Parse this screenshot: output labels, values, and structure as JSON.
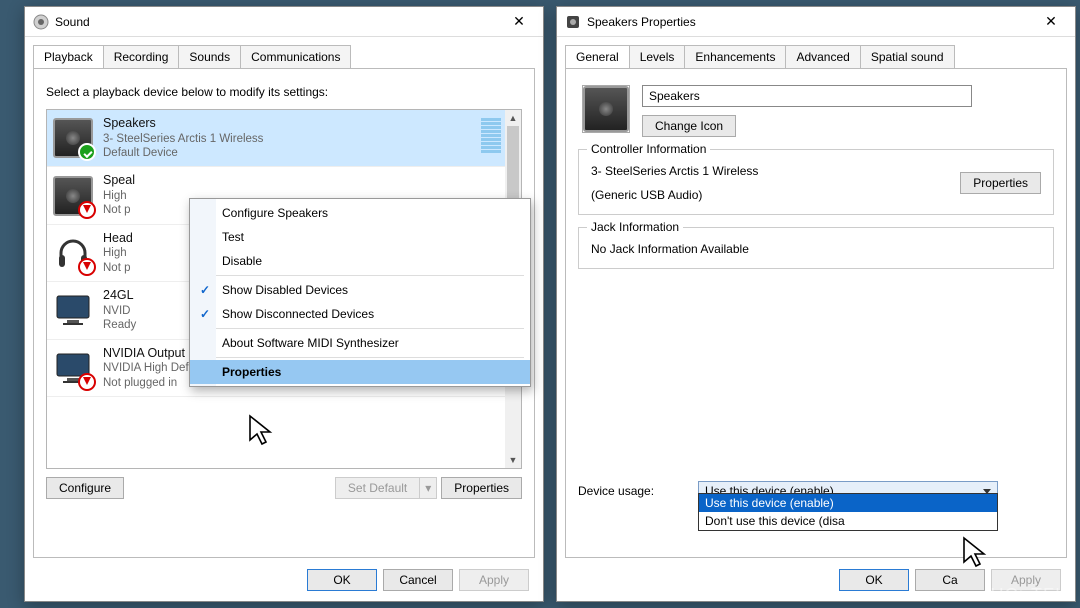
{
  "sound_dialog": {
    "title": "Sound",
    "tabs": [
      "Playback",
      "Recording",
      "Sounds",
      "Communications"
    ],
    "instruction": "Select a playback device below to modify its settings:",
    "devices": [
      {
        "name": "Speakers",
        "line2": "3- SteelSeries Arctis 1 Wireless",
        "line3": "Default Device",
        "selected": true,
        "icon": "speaker",
        "badge": "green"
      },
      {
        "name": "Speal",
        "line2": "High",
        "line3": "Not p",
        "icon": "speaker",
        "badge": "red"
      },
      {
        "name": "Head",
        "line2": "High",
        "line3": "Not p",
        "icon": "headphones",
        "badge": "red"
      },
      {
        "name": "24GL",
        "line2": "NVID",
        "line3": "Ready",
        "icon": "monitor",
        "badge": ""
      },
      {
        "name": "NVIDIA Output",
        "line2": "NVIDIA High Definit... Audio",
        "line3": "Not plugged in",
        "icon": "monitor",
        "badge": "red"
      }
    ],
    "context_menu": {
      "items": [
        {
          "label": "Configure Speakers",
          "type": "item"
        },
        {
          "label": "Test",
          "type": "item"
        },
        {
          "label": "Disable",
          "type": "item"
        },
        {
          "type": "sep"
        },
        {
          "label": "Show Disabled Devices",
          "type": "check"
        },
        {
          "label": "Show Disconnected Devices",
          "type": "check"
        },
        {
          "type": "sep"
        },
        {
          "label": "About Software MIDI Synthesizer",
          "type": "item"
        },
        {
          "type": "sep"
        },
        {
          "label": "Properties",
          "type": "item",
          "highlight": true
        }
      ]
    },
    "buttons": {
      "configure": "Configure",
      "set_default": "Set Default",
      "properties": "Properties",
      "ok": "OK",
      "cancel": "Cancel",
      "apply": "Apply"
    }
  },
  "props_dialog": {
    "title": "Speakers Properties",
    "tabs": [
      "General",
      "Levels",
      "Enhancements",
      "Advanced",
      "Spatial sound"
    ],
    "name_value": "Speakers",
    "change_icon": "Change Icon",
    "controller_group": "Controller Information",
    "controller_line1": "3- SteelSeries Arctis 1 Wireless",
    "controller_line2": "(Generic USB Audio)",
    "controller_properties": "Properties",
    "jack_group": "Jack Information",
    "jack_text": "No Jack Information Available",
    "device_usage_label": "Device usage:",
    "device_usage_value": "Use this device (enable)",
    "dropdown_options": [
      "Use this device (enable)",
      "Don't use this device (disa"
    ],
    "buttons": {
      "ok": "OK",
      "cancel": "Ca",
      "apply": "Apply"
    }
  },
  "watermark": "UG>TFIX"
}
